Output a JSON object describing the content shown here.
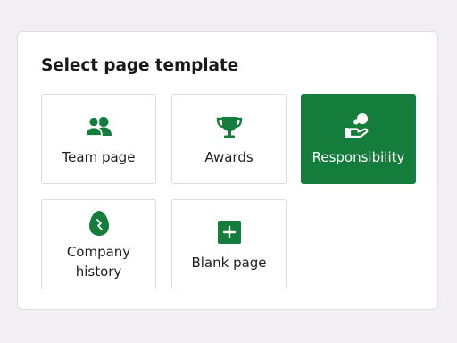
{
  "dialog": {
    "title": "Select page template",
    "templates": [
      {
        "label": "Team page",
        "icon": "team-icon",
        "selected": false
      },
      {
        "label": "Awards",
        "icon": "trophy-icon",
        "selected": false
      },
      {
        "label": "Responsibility",
        "icon": "hand-coin-icon",
        "selected": true
      },
      {
        "label": "Company\nhistory",
        "icon": "egg-icon",
        "selected": false
      },
      {
        "label": "Blank page",
        "icon": "plus-square-icon",
        "selected": false
      }
    ]
  },
  "colors": {
    "accent": "#147d3c",
    "background": "#f1eff4",
    "card": "#ffffff"
  }
}
